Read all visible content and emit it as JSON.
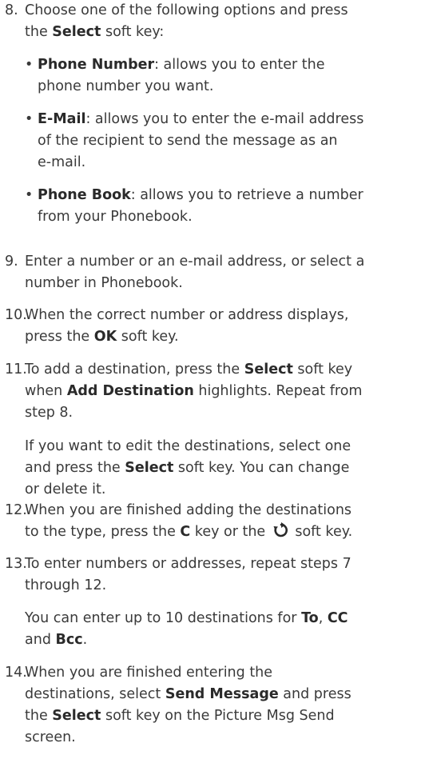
{
  "steps": {
    "s8": {
      "num": "8.",
      "l1": "Choose one of the following options and press",
      "l2a": "the ",
      "l2b": "Select",
      "l2c": " soft key:",
      "bullets": [
        {
          "bold": "Phone Number",
          "l1": ": allows you to enter the",
          "l2": "phone number you want."
        },
        {
          "bold": "E-Mail",
          "l1": ": allows you to enter the e-mail address",
          "l2": "of the recipient to send the message as an",
          "l3": "e-mail."
        },
        {
          "bold": "Phone Book",
          "l1": ": allows you to retrieve a number",
          "l2": "from your Phonebook."
        }
      ]
    },
    "s9": {
      "num": "9.",
      "l1": "Enter a number or an e-mail address, or select a",
      "l2": "number in Phonebook."
    },
    "s10": {
      "num": "10.",
      "l1": "When the correct number or address displays,",
      "l2a": "press the ",
      "l2b": "OK",
      "l2c": " soft key."
    },
    "s11": {
      "num": "11.",
      "l1a": "To add a destination, press the ",
      "l1b": "Select",
      "l1c": " soft key",
      "l2a": "when ",
      "l2b": "Add Destination",
      "l2c": " highlights. Repeat from",
      "l3": "step 8.",
      "n1": "If you want to edit the destinations, select one",
      "n2a": "and press the ",
      "n2b": "Select",
      "n2c": " soft key. You can change",
      "n3": "or delete it."
    },
    "s12": {
      "num": "12.",
      "l1": "When you are finished adding the destinations",
      "l2a": "to the type, press the ",
      "l2b": "C",
      "l2c": " key or the ",
      "l2d": " soft key."
    },
    "s13": {
      "num": "13.",
      "l1": "To enter numbers or addresses, repeat steps 7",
      "l2": "through 12.",
      "n1a": "You can enter up to 10 destinations for ",
      "n1b": "To",
      "n1c": ", ",
      "n1d": "CC",
      "n2a": "and ",
      "n2b": "Bcc",
      "n2c": "."
    },
    "s14": {
      "num": "14.",
      "l1": "When you are finished entering the",
      "l2a": "destinations, select ",
      "l2b": "Send Message",
      "l2c": " and press",
      "l3a": "the ",
      "l3b": "Select",
      "l3c": " soft key on the Picture Msg Send",
      "l4": "screen."
    }
  }
}
